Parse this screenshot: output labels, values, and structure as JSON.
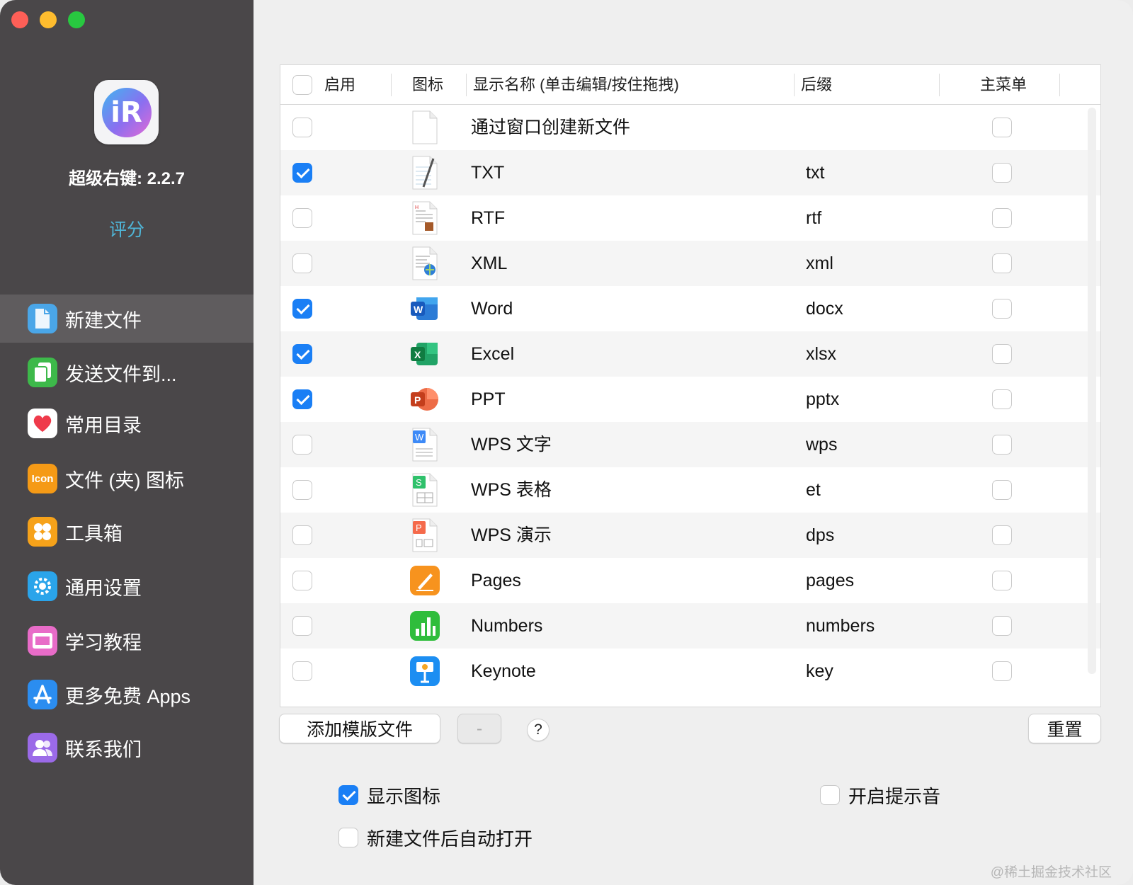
{
  "sidebar": {
    "app_name": "超级右键: 2.2.7",
    "rate": "评分",
    "items": [
      {
        "label": "新建文件",
        "icon": "document-icon",
        "color": "#4aa6e8",
        "active": true
      },
      {
        "label": "发送文件到...",
        "icon": "copy-icon",
        "color": "#3db94a",
        "active": false
      },
      {
        "label": "常用目录",
        "icon": "heart-icon",
        "color": "#ffffff",
        "active": false
      },
      {
        "label": "文件 (夹) 图标",
        "icon": "icon-badge-icon",
        "color": "#f59a16",
        "active": false
      },
      {
        "label": "工具箱",
        "icon": "toolbox-icon",
        "color": "#f6a21a",
        "active": false
      },
      {
        "label": "通用设置",
        "icon": "gear-icon",
        "color": "#2aa4ea",
        "active": false
      },
      {
        "label": "学习教程",
        "icon": "film-icon",
        "color": "#e86cc8",
        "active": false
      },
      {
        "label": "更多免费 Apps",
        "icon": "app-store-icon",
        "color": "#2b8df0",
        "active": false
      },
      {
        "label": "联系我们",
        "icon": "people-icon",
        "color": "#9b6ae8",
        "active": false
      }
    ]
  },
  "table": {
    "headers": {
      "enable": "启用",
      "icon": "图标",
      "name": "显示名称 (单击编辑/按住拖拽)",
      "suffix": "后缀",
      "main_menu": "主菜单"
    },
    "rows": [
      {
        "enabled": false,
        "name": "通过窗口创建新文件",
        "suffix": "",
        "icon": "blank-file-icon",
        "main": false
      },
      {
        "enabled": true,
        "name": "TXT",
        "suffix": "txt",
        "icon": "txt-file-icon",
        "main": false
      },
      {
        "enabled": false,
        "name": "RTF",
        "suffix": "rtf",
        "icon": "rtf-file-icon",
        "main": false
      },
      {
        "enabled": false,
        "name": "XML",
        "suffix": "xml",
        "icon": "xml-file-icon",
        "main": false
      },
      {
        "enabled": true,
        "name": "Word",
        "suffix": "docx",
        "icon": "word-icon",
        "main": false
      },
      {
        "enabled": true,
        "name": "Excel",
        "suffix": "xlsx",
        "icon": "excel-icon",
        "main": false
      },
      {
        "enabled": true,
        "name": "PPT",
        "suffix": "pptx",
        "icon": "powerpoint-icon",
        "main": false
      },
      {
        "enabled": false,
        "name": "WPS 文字",
        "suffix": "wps",
        "icon": "wps-writer-icon",
        "main": false
      },
      {
        "enabled": false,
        "name": "WPS 表格",
        "suffix": "et",
        "icon": "wps-spreadsheet-icon",
        "main": false
      },
      {
        "enabled": false,
        "name": "WPS 演示",
        "suffix": "dps",
        "icon": "wps-presentation-icon",
        "main": false
      },
      {
        "enabled": false,
        "name": "Pages",
        "suffix": "pages",
        "icon": "pages-icon",
        "main": false
      },
      {
        "enabled": false,
        "name": "Numbers",
        "suffix": "numbers",
        "icon": "numbers-icon",
        "main": false
      },
      {
        "enabled": false,
        "name": "Keynote",
        "suffix": "key",
        "icon": "keynote-icon",
        "main": false
      }
    ]
  },
  "buttons": {
    "add_template": "添加模版文件",
    "remove": "-",
    "help": "?",
    "reset": "重置"
  },
  "options": {
    "show_icon": {
      "label": "显示图标",
      "checked": true
    },
    "sound": {
      "label": "开启提示音",
      "checked": false
    },
    "auto_open": {
      "label": "新建文件后自动打开",
      "checked": false
    }
  },
  "watermark": "@稀土掘金技术社区"
}
